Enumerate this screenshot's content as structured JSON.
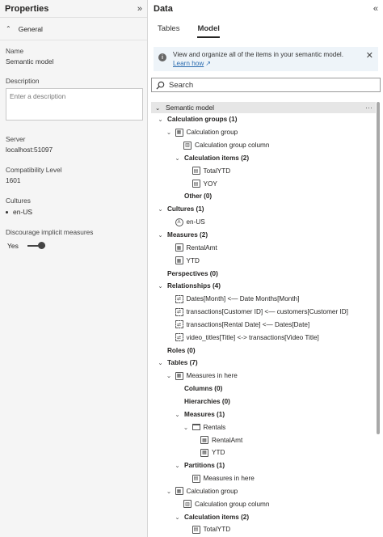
{
  "properties": {
    "title": "Properties",
    "collapse_icon": "double-chevron-right-icon",
    "section": "General",
    "name_label": "Name",
    "name_value": "Semantic model",
    "description_label": "Description",
    "description_placeholder": "Enter a description",
    "server_label": "Server",
    "server_value": "localhost:51097",
    "compat_label": "Compatibility Level",
    "compat_value": "1601",
    "cultures_label": "Cultures",
    "culture_item": "en-US",
    "implicit_label": "Discourage implicit measures",
    "implicit_value": "Yes",
    "implicit_on": true
  },
  "data_pane": {
    "title": "Data",
    "tabs": [
      "Tables",
      "Model"
    ],
    "active_tab": "Model",
    "info": {
      "text": "View and organize all of the items in your semantic model. ",
      "link": "Learn how"
    },
    "search_placeholder": "Search",
    "root": "Semantic model",
    "rows": [
      {
        "text": "Calculation groups (1)",
        "bold": true,
        "indent": 0,
        "toggle": "open",
        "icon": ""
      },
      {
        "text": "Calculation group",
        "bold": false,
        "indent": 1,
        "toggle": "open",
        "icon": "calc-group-icon"
      },
      {
        "text": "Calculation group column",
        "bold": false,
        "indent": 2,
        "toggle": "",
        "icon": "column-icon"
      },
      {
        "text": "Calculation items (2)",
        "bold": true,
        "indent": 2,
        "toggle": "open",
        "icon": ""
      },
      {
        "text": "TotalYTD",
        "bold": false,
        "indent": 3,
        "toggle": "",
        "icon": "calc-item-icon"
      },
      {
        "text": "YOY",
        "bold": false,
        "indent": 3,
        "toggle": "",
        "icon": "calc-item-icon"
      },
      {
        "text": "Other (0)",
        "bold": true,
        "indent": 2,
        "toggle": "",
        "icon": ""
      },
      {
        "text": "Cultures (1)",
        "bold": true,
        "indent": 0,
        "toggle": "open",
        "icon": ""
      },
      {
        "text": "en-US",
        "bold": false,
        "indent": 1,
        "toggle": "",
        "icon": "culture-icon"
      },
      {
        "text": "Measures (2)",
        "bold": true,
        "indent": 0,
        "toggle": "open",
        "icon": ""
      },
      {
        "text": "RentalAmt",
        "bold": false,
        "indent": 1,
        "toggle": "",
        "icon": "measure-icon"
      },
      {
        "text": "YTD",
        "bold": false,
        "indent": 1,
        "toggle": "",
        "icon": "measure-icon"
      },
      {
        "text": "Perspectives (0)",
        "bold": true,
        "indent": 0,
        "toggle": "",
        "icon": ""
      },
      {
        "text": "Relationships (4)",
        "bold": true,
        "indent": 0,
        "toggle": "open",
        "icon": ""
      },
      {
        "text": "Dates[Month] <— Date Months[Month]",
        "bold": false,
        "indent": 1,
        "toggle": "",
        "icon": "relationship-icon"
      },
      {
        "text": "transactions[Customer ID] <— customers[Customer ID]",
        "bold": false,
        "indent": 1,
        "toggle": "",
        "icon": "relationship-icon"
      },
      {
        "text": "transactions[Rental Date] <— Dates[Date]",
        "bold": false,
        "indent": 1,
        "toggle": "",
        "icon": "relationship-icon"
      },
      {
        "text": "video_titles[Title] <-> transactions[Video Title]",
        "bold": false,
        "indent": 1,
        "toggle": "",
        "icon": "relationship-icon"
      },
      {
        "text": "Roles (0)",
        "bold": true,
        "indent": 0,
        "toggle": "",
        "icon": ""
      },
      {
        "text": "Tables (7)",
        "bold": true,
        "indent": 0,
        "toggle": "open",
        "icon": ""
      },
      {
        "text": "Measures in here",
        "bold": false,
        "indent": 1,
        "toggle": "open",
        "icon": "table-icon"
      },
      {
        "text": "Columns (0)",
        "bold": true,
        "indent": 2,
        "toggle": "",
        "icon": ""
      },
      {
        "text": "Hierarchies (0)",
        "bold": true,
        "indent": 2,
        "toggle": "",
        "icon": ""
      },
      {
        "text": "Measures (1)",
        "bold": true,
        "indent": 2,
        "toggle": "open",
        "icon": ""
      },
      {
        "text": "Rentals",
        "bold": false,
        "indent": 3,
        "toggle": "open",
        "icon": "folder-icon"
      },
      {
        "text": "RentalAmt",
        "bold": false,
        "indent": 4,
        "toggle": "",
        "icon": "measure-icon"
      },
      {
        "text": "YTD",
        "bold": false,
        "indent": 4,
        "toggle": "",
        "icon": "measure-icon"
      },
      {
        "text": "Partitions (1)",
        "bold": true,
        "indent": 2,
        "toggle": "open",
        "icon": ""
      },
      {
        "text": "Measures in here",
        "bold": false,
        "indent": 3,
        "toggle": "",
        "icon": "partition-icon"
      },
      {
        "text": "Calculation group",
        "bold": false,
        "indent": 1,
        "toggle": "open",
        "icon": "calc-group-icon"
      },
      {
        "text": "Calculation group column",
        "bold": false,
        "indent": 2,
        "toggle": "",
        "icon": "column-icon"
      },
      {
        "text": "Calculation items (2)",
        "bold": true,
        "indent": 2,
        "toggle": "open",
        "icon": ""
      },
      {
        "text": "TotalYTD",
        "bold": false,
        "indent": 3,
        "toggle": "",
        "icon": "calc-item-icon"
      }
    ]
  }
}
